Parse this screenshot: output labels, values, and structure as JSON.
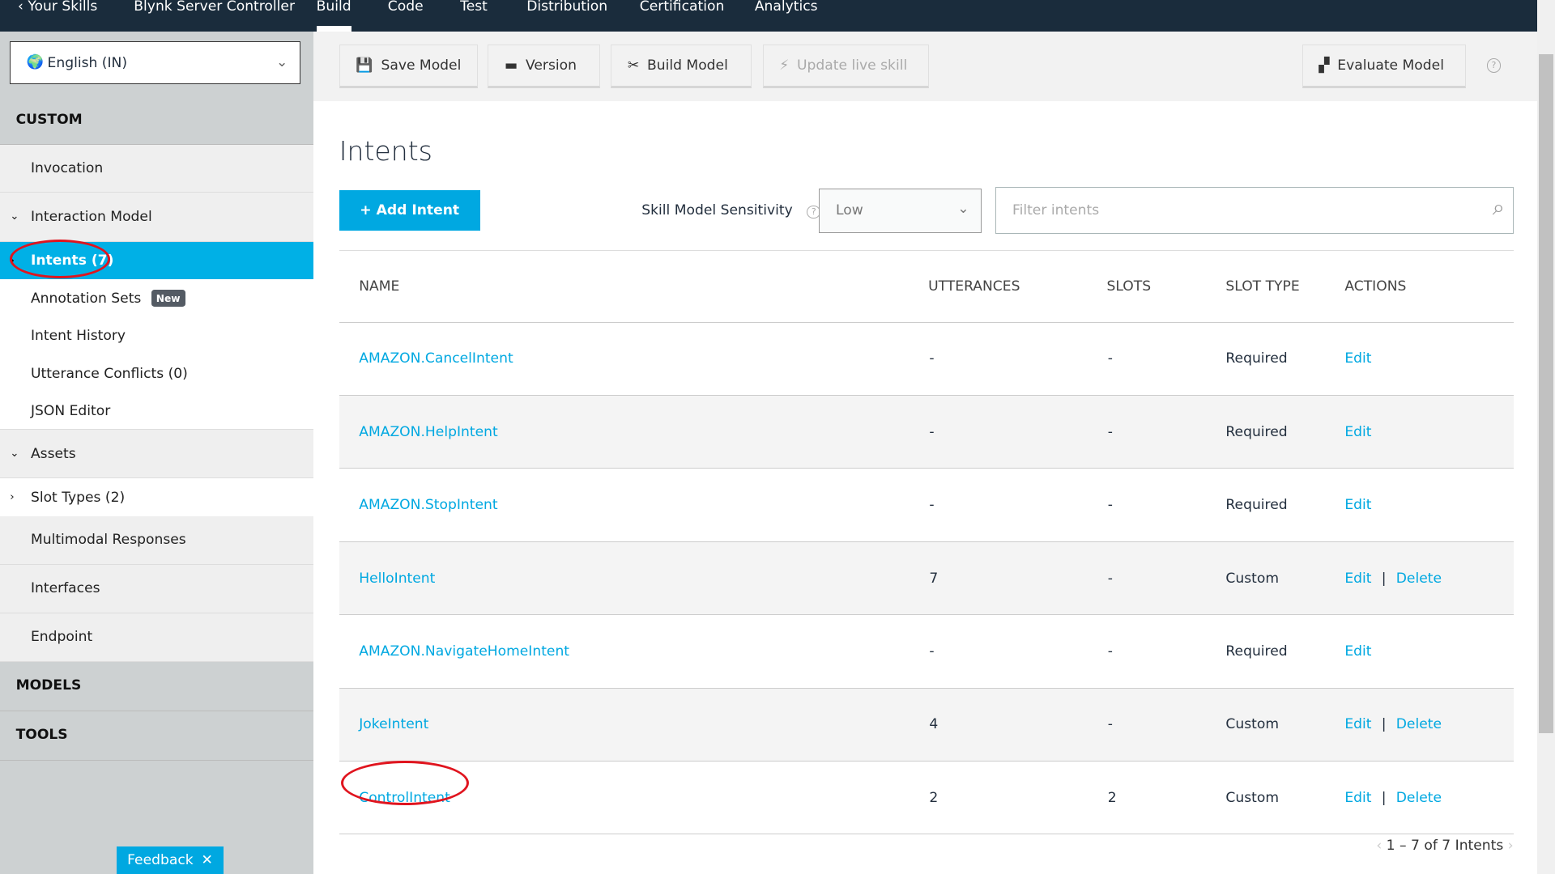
{
  "topnav": {
    "back": "Your Skills",
    "skill": "Blynk Server Controller",
    "tabs": [
      "Build",
      "Code",
      "Test",
      "Distribution",
      "Certification",
      "Analytics"
    ],
    "active": "Build"
  },
  "sidebar": {
    "language": "English (IN)",
    "custom": "CUSTOM",
    "invocation": "Invocation",
    "interaction_model": "Interaction Model",
    "intents": "Intents (7)",
    "annotation_sets": "Annotation Sets",
    "new_badge": "New",
    "intent_history": "Intent History",
    "utterance_conflicts": "Utterance Conflicts (0)",
    "json_editor": "JSON Editor",
    "assets": "Assets",
    "slot_types": "Slot Types (2)",
    "multimodal": "Multimodal Responses",
    "interfaces": "Interfaces",
    "endpoint": "Endpoint",
    "models": "MODELS",
    "tools": "TOOLS",
    "feedback": "Feedback"
  },
  "toolbar": {
    "save": "Save Model",
    "version": "Version",
    "build": "Build Model",
    "update": "Update live skill",
    "evaluate": "Evaluate Model"
  },
  "main": {
    "title": "Intents",
    "add": "+ Add Intent",
    "sensitivity_label": "Skill Model Sensitivity",
    "sensitivity_value": "Low",
    "filter_placeholder": "Filter intents",
    "pager": "1 – 7 of 7 Intents"
  },
  "table": {
    "headers": [
      "NAME",
      "UTTERANCES",
      "SLOTS",
      "SLOT TYPE",
      "ACTIONS"
    ],
    "rows": [
      {
        "name": "AMAZON.CancelIntent",
        "utterances": "-",
        "slots": "-",
        "type": "Required",
        "edit": "Edit",
        "delete": ""
      },
      {
        "name": "AMAZON.HelpIntent",
        "utterances": "-",
        "slots": "-",
        "type": "Required",
        "edit": "Edit",
        "delete": ""
      },
      {
        "name": "AMAZON.StopIntent",
        "utterances": "-",
        "slots": "-",
        "type": "Required",
        "edit": "Edit",
        "delete": ""
      },
      {
        "name": "HelloIntent",
        "utterances": "7",
        "slots": "-",
        "type": "Custom",
        "edit": "Edit",
        "delete": "Delete"
      },
      {
        "name": "AMAZON.NavigateHomeIntent",
        "utterances": "-",
        "slots": "-",
        "type": "Required",
        "edit": "Edit",
        "delete": ""
      },
      {
        "name": "JokeIntent",
        "utterances": "4",
        "slots": "-",
        "type": "Custom",
        "edit": "Edit",
        "delete": "Delete"
      },
      {
        "name": "ControlIntent",
        "utterances": "2",
        "slots": "2",
        "type": "Custom",
        "edit": "Edit",
        "delete": "Delete"
      }
    ]
  },
  "colors": {
    "accent": "#00a8e1",
    "topbar": "#1a2c3c",
    "annotation": "#e0141e"
  }
}
